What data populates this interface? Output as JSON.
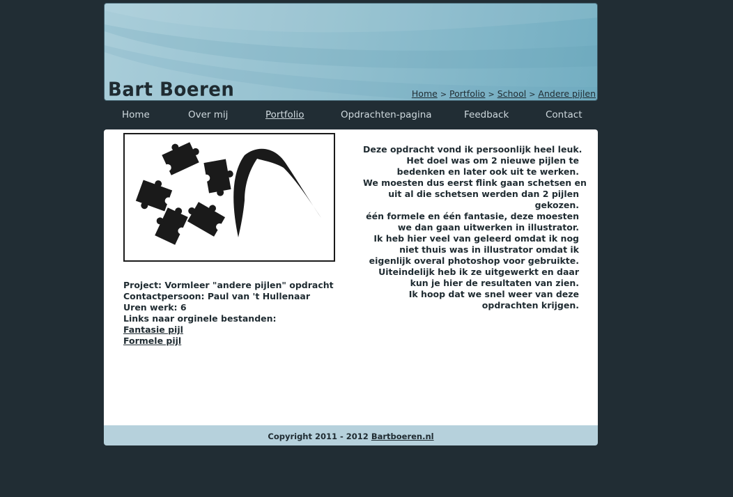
{
  "header": {
    "brand": "Bart Boeren",
    "breadcrumb": [
      {
        "label": "Home"
      },
      {
        "label": "Portfolio"
      },
      {
        "label": "School"
      },
      {
        "label": "Andere pijlen"
      }
    ],
    "breadcrumb_separator": ">"
  },
  "nav": {
    "items": [
      {
        "label": "Home"
      },
      {
        "label": "Over mij"
      },
      {
        "label": "Portfolio",
        "active": true
      },
      {
        "label": "Opdrachten-pagina"
      },
      {
        "label": "Feedback"
      },
      {
        "label": "Contact"
      }
    ]
  },
  "main": {
    "image_alt": "Fantasie pijl (puzzle pieces) and formele pijl (curved arrow)",
    "info": {
      "project": "Project: Vormleer \"andere pijlen\" opdracht",
      "contact": "Contactpersoon: Paul van 't Hullenaar",
      "hours": "Uren werk: 6",
      "links_label": "Links naar orginele bestanden:",
      "links": [
        {
          "label": "Fantasie pijl"
        },
        {
          "label": "Formele pijl"
        }
      ]
    },
    "story_lines": [
      "Deze opdracht vond ik persoonlijk heel leuk.",
      "Het doel was om 2 nieuwe pijlen te",
      "bedenken en later ook uit te werken.",
      "We moesten dus eerst flink gaan schetsen en",
      "uit al die schetsen werden dan 2 pijlen",
      "gekozen.",
      "één formele en één fantasie, deze moesten",
      "we dan gaan uitwerken in illustrator.",
      "Ik heb hier veel van geleerd omdat ik nog",
      "niet thuis was in illustrator omdat ik",
      "eigenlijk overal photoshop voor gebruikte.",
      "Uiteindelijk heb ik ze uitgewerkt en daar",
      "kun je hier de resultaten van zien.",
      "Ik hoop dat we snel weer van deze",
      "opdrachten krijgen."
    ]
  },
  "footer": {
    "copyright": "Copyright 2011 - 2012",
    "link": "Bartboeren.nl"
  },
  "colors": {
    "background": "#212d34",
    "header_light": "#a9cdd9",
    "header_dark": "#73aec2",
    "footer": "#b6d1dc",
    "text": "#1f2b31"
  }
}
